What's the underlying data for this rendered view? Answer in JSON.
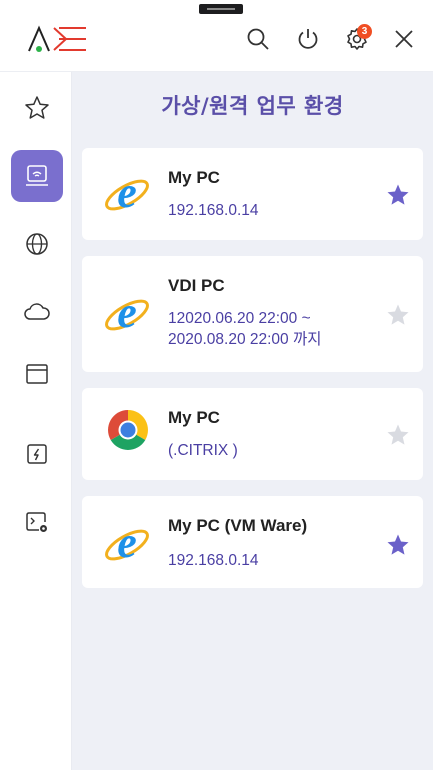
{
  "header": {
    "logo_name": "app-logo",
    "search_icon": "search-icon",
    "power_icon": "power-icon",
    "settings_icon": "gear-icon",
    "notification_count": "3",
    "close_icon": "close-icon"
  },
  "sidebar": {
    "items": [
      {
        "name": "favorites",
        "icon": "star-outline-icon",
        "active": false
      },
      {
        "name": "remote-desktop",
        "icon": "laptop-signal-icon",
        "active": true
      },
      {
        "name": "web",
        "icon": "globe-icon",
        "active": false
      },
      {
        "name": "cloud",
        "icon": "cloud-icon",
        "active": false
      },
      {
        "name": "window",
        "icon": "browser-window-icon",
        "active": false
      },
      {
        "name": "security",
        "icon": "shield-icon",
        "active": false
      },
      {
        "name": "terminal",
        "icon": "terminal-gear-icon",
        "active": false
      }
    ]
  },
  "main": {
    "title": "가상/원격 업무 환경",
    "cards": [
      {
        "name": "My PC",
        "detail_line1": "192.168.0.14",
        "detail_line2": "",
        "app_icon": "internet-explorer-icon",
        "favorite": true
      },
      {
        "name": "VDI PC",
        "detail_line1": "12020.06.20  22:00 ~",
        "detail_line2": "2020.08.20  22:00 까지",
        "app_icon": "internet-explorer-icon",
        "favorite": false
      },
      {
        "name": "My PC",
        "detail_line1": "(.CITRIX )",
        "detail_line2": "",
        "app_icon": "chrome-icon",
        "favorite": false
      },
      {
        "name": "My PC (VM Ware)",
        "detail_line1": "192.168.0.14",
        "detail_line2": "",
        "app_icon": "internet-explorer-icon",
        "favorite": true
      }
    ]
  },
  "colors": {
    "accent": "#7a6fce",
    "title": "#5a4fa8",
    "detail_text": "#4a3fa3",
    "star_on": "#6b61c9",
    "star_off": "#d9dbe1",
    "badge": "#f04e23"
  }
}
